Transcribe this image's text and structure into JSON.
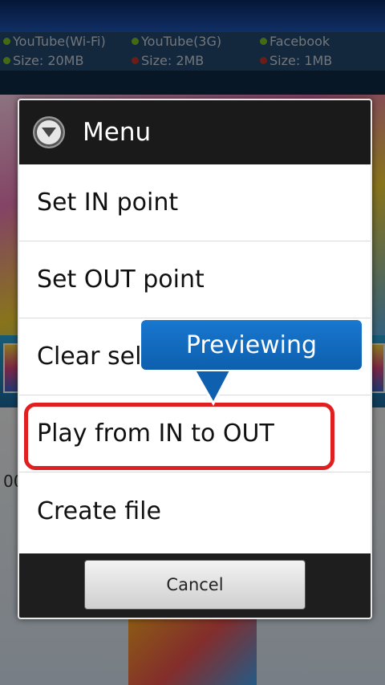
{
  "background_app": {
    "share_options": [
      {
        "name": "YouTube(Wi-Fi)",
        "size": "Size: 20MB",
        "status": "green"
      },
      {
        "name": "YouTube(3G)",
        "size": "Size: 2MB",
        "status": "red"
      },
      {
        "name": "Facebook",
        "size": "Size: 1MB",
        "status": "red"
      }
    ],
    "time_partial": "00"
  },
  "dialog": {
    "title": "Menu",
    "icon": "chevron-down-circle-icon",
    "items": [
      {
        "label": "Set IN point"
      },
      {
        "label": "Set OUT point"
      },
      {
        "label": "Clear sel"
      },
      {
        "label": "Play from IN to OUT"
      },
      {
        "label": "Create file"
      }
    ],
    "cancel_label": "Cancel"
  },
  "annotation": {
    "callout_text": "Previewing",
    "highlight_color": "#e02020",
    "callout_color": "#1470c4"
  }
}
